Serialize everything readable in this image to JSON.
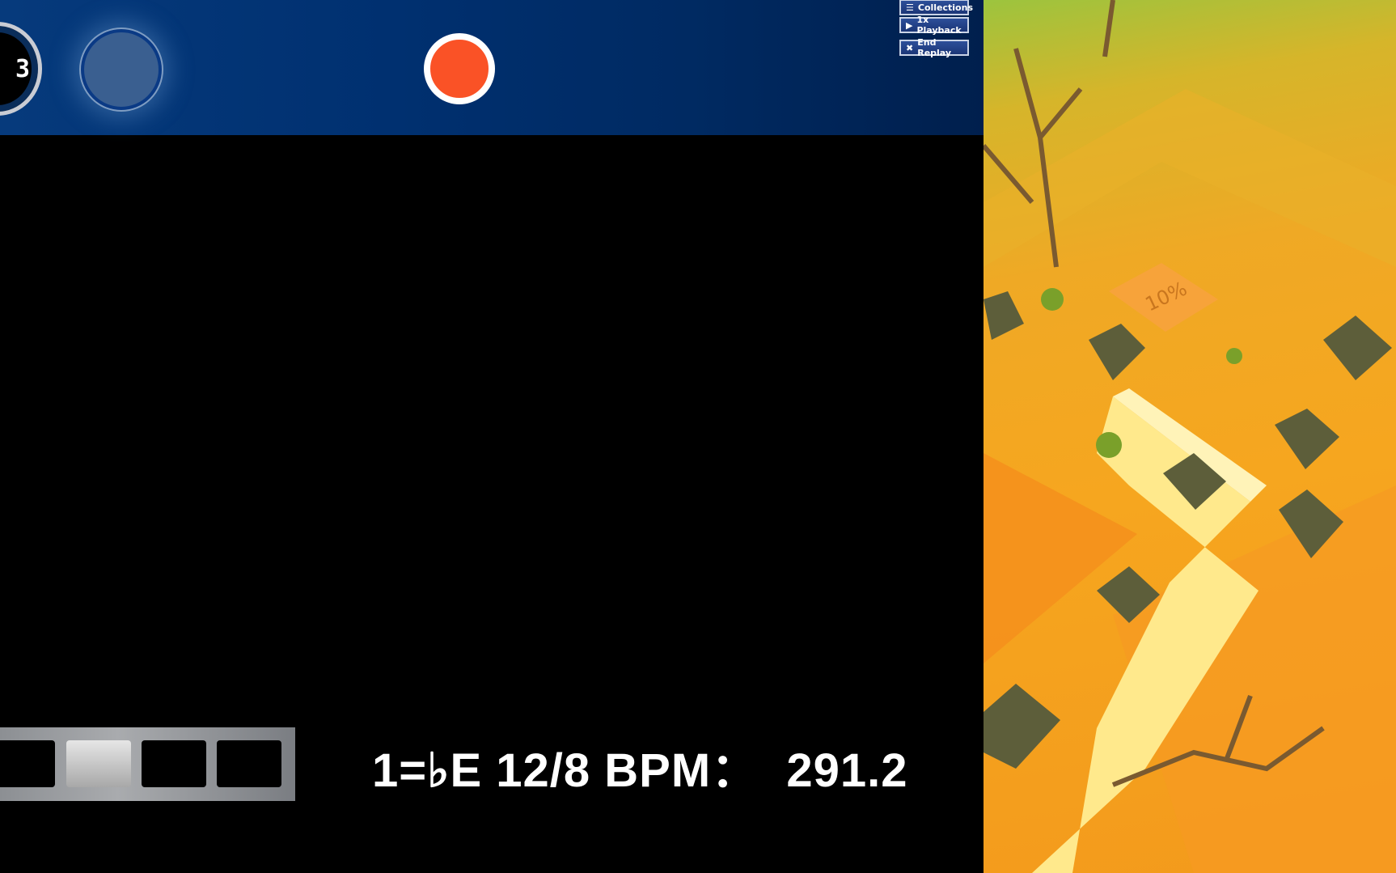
{
  "hud": {
    "lane_left_label": "3",
    "hit_color": "#fa5226"
  },
  "replay_controls": [
    {
      "icon": "list-icon",
      "label": "Collections"
    },
    {
      "icon": "play-icon",
      "label": "1x Playback"
    },
    {
      "icon": "close-icon",
      "label": "End Replay"
    }
  ],
  "keys": {
    "count": 4,
    "active_index": 1
  },
  "song_info": "1=♭E 12/8 BPM：  291.2",
  "scene": {
    "tile_label": "10%"
  }
}
